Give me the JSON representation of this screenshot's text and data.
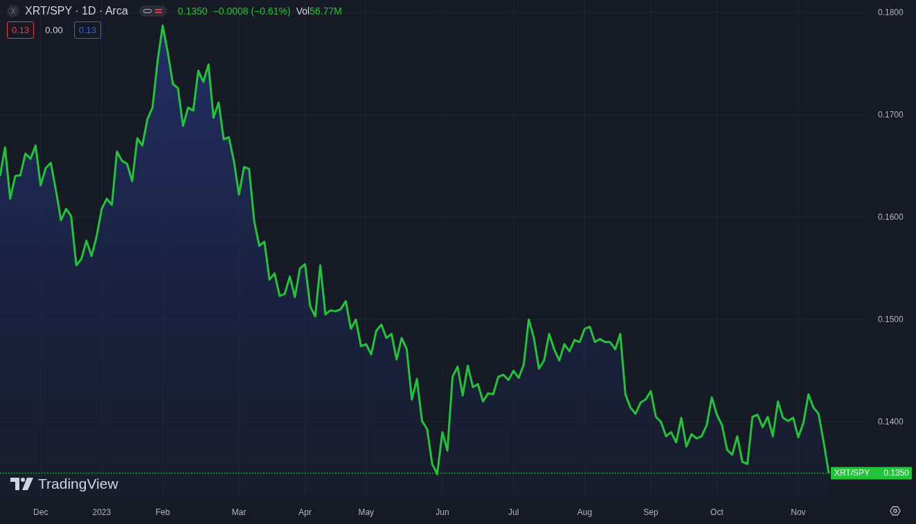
{
  "legend": {
    "symbol_letter": "X",
    "title": "XRT/SPY · 1D · Arca",
    "price": "0.1350",
    "change": "−0.0008 (−0.61%)",
    "volume_label": "Vol",
    "volume": "56.77M",
    "quotes": [
      {
        "kind": "sell",
        "text": "0.13"
      },
      {
        "kind": "spread",
        "text": "0.00"
      },
      {
        "kind": "buy",
        "text": "0.13"
      }
    ]
  },
  "logo": "TradingView",
  "chart_data": {
    "type": "area",
    "categories": [
      null,
      null,
      null,
      null,
      null,
      null,
      null,
      null,
      "Dec",
      null,
      null,
      null,
      null,
      null,
      null,
      null,
      null,
      null,
      null,
      null,
      "2023",
      null,
      null,
      null,
      null,
      null,
      null,
      null,
      null,
      null,
      null,
      null,
      "Feb",
      null,
      null,
      null,
      null,
      null,
      null,
      null,
      null,
      null,
      null,
      null,
      null,
      null,
      null,
      "Mar",
      null,
      null,
      null,
      null,
      null,
      null,
      null,
      null,
      null,
      null,
      null,
      null,
      "Apr",
      null,
      null,
      null,
      null,
      null,
      null,
      null,
      null,
      null,
      null,
      null,
      "May",
      null,
      null,
      null,
      null,
      null,
      null,
      null,
      null,
      null,
      null,
      null,
      null,
      null,
      null,
      "Jun",
      null,
      null,
      null,
      null,
      null,
      null,
      null,
      null,
      null,
      null,
      null,
      null,
      null,
      "Jul",
      null,
      null,
      null,
      null,
      null,
      null,
      null,
      null,
      null,
      null,
      null,
      null,
      null,
      "Aug",
      null,
      null,
      null,
      null,
      null,
      null,
      null,
      null,
      null,
      null,
      null,
      null,
      "Sep",
      null,
      null,
      null,
      null,
      null,
      null,
      null,
      null,
      null,
      null,
      null,
      null,
      "Oct",
      null,
      null,
      null,
      null,
      null,
      null,
      null,
      null,
      null,
      null,
      null,
      null,
      null,
      null,
      null,
      "Nov",
      null,
      null,
      null,
      null,
      null,
      null
    ],
    "series": [
      {
        "name": "XRT/SPY",
        "color": "#22c43a",
        "values": [
          0.164,
          0.1668,
          0.1618,
          0.164,
          0.1641,
          0.1662,
          0.1657,
          0.167,
          0.1631,
          0.1648,
          0.1653,
          0.1626,
          0.1597,
          0.1608,
          0.1601,
          0.1553,
          0.1559,
          0.1577,
          0.1562,
          0.1581,
          0.1608,
          0.1618,
          0.1612,
          0.1664,
          0.1655,
          0.1652,
          0.1635,
          0.1677,
          0.167,
          0.1696,
          0.1707,
          0.1753,
          0.1787,
          0.1761,
          0.173,
          0.1726,
          0.1689,
          0.1707,
          0.1704,
          0.1743,
          0.1732,
          0.1749,
          0.1697,
          0.1712,
          0.1676,
          0.1678,
          0.1655,
          0.1622,
          0.1649,
          0.1647,
          0.1596,
          0.1572,
          0.1576,
          0.1539,
          0.1545,
          0.1523,
          0.1525,
          0.1542,
          0.1522,
          0.155,
          0.1554,
          0.1513,
          0.1503,
          0.1553,
          0.1505,
          0.1509,
          0.1508,
          0.151,
          0.1518,
          0.1491,
          0.15,
          0.1474,
          0.1476,
          0.1466,
          0.1489,
          0.1495,
          0.1482,
          0.1486,
          0.1461,
          0.1482,
          0.1471,
          0.1422,
          0.1442,
          0.1401,
          0.1393,
          0.1359,
          0.1349,
          0.139,
          0.1372,
          0.1444,
          0.1454,
          0.1426,
          0.1455,
          0.1434,
          0.1437,
          0.142,
          0.1428,
          0.1427,
          0.1444,
          0.1446,
          0.1441,
          0.145,
          0.1443,
          0.1456,
          0.15,
          0.1482,
          0.1452,
          0.146,
          0.1486,
          0.1471,
          0.146,
          0.1476,
          0.1469,
          0.148,
          0.1478,
          0.1491,
          0.1493,
          0.1478,
          0.1481,
          0.1478,
          0.1478,
          0.1471,
          0.1486,
          0.1427,
          0.1414,
          0.1408,
          0.1419,
          0.1422,
          0.143,
          0.1405,
          0.14,
          0.1386,
          0.139,
          0.138,
          0.1404,
          0.1376,
          0.1388,
          0.1384,
          0.1386,
          0.1397,
          0.1424,
          0.1407,
          0.1397,
          0.1373,
          0.1368,
          0.1386,
          0.1361,
          0.1359,
          0.1405,
          0.1407,
          0.1395,
          0.1405,
          0.1386,
          0.142,
          0.1404,
          0.1401,
          0.1404,
          0.1385,
          0.1399,
          0.1427,
          0.1414,
          0.1408,
          0.138,
          0.135
        ]
      }
    ],
    "ylim": [
      0.1326,
      0.1812
    ],
    "grid": true,
    "ref_lines": [
      {
        "axis": "y",
        "value": 0.135
      }
    ],
    "yticks": [
      {
        "value": 0.14,
        "label": "0.1400"
      },
      {
        "value": 0.15,
        "label": "0.1500"
      },
      {
        "value": 0.16,
        "label": "0.1600"
      },
      {
        "value": 0.17,
        "label": "0.1700"
      },
      {
        "value": 0.18,
        "label": "0.1800"
      }
    ]
  },
  "last_price_label": {
    "price": "0.1350"
  }
}
